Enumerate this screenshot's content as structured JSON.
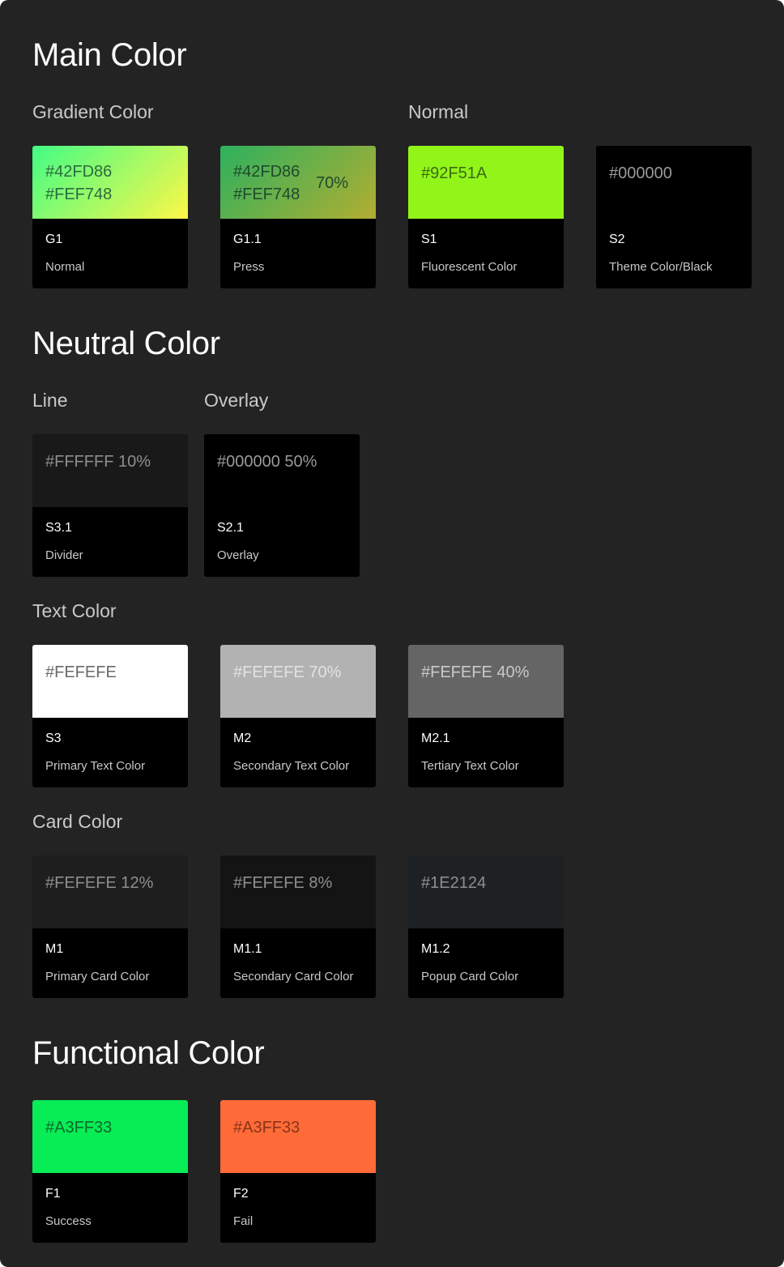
{
  "sections": {
    "main": {
      "title": "Main Color",
      "gradient_heading": "Gradient Color",
      "normal_heading": "Normal",
      "cards": [
        {
          "hex1": "#42FD86",
          "hex2": "#FEF748",
          "code": "G1",
          "label": "Normal"
        },
        {
          "hex1": "#42FD86",
          "hex2": "#FEF748",
          "pct": "70%",
          "code": "G1.1",
          "label": "Press"
        },
        {
          "hex1": "#92F51A",
          "code": "S1",
          "label": "Fluorescent Color"
        },
        {
          "hex1": "#000000",
          "code": "S2",
          "label": "Theme Color/Black"
        }
      ]
    },
    "neutral": {
      "title": "Neutral Color",
      "line_heading": "Line",
      "overlay_heading": "Overlay",
      "text_heading": "Text Color",
      "card_heading": "Card Color",
      "line_cards": [
        {
          "hex1": "#FFFFFF 10%",
          "code": "S3.1",
          "label": "Divider"
        },
        {
          "hex1": "#000000 50%",
          "code": "S2.1",
          "label": "Overlay"
        }
      ],
      "text_cards": [
        {
          "hex1": "#FEFEFE",
          "code": "S3",
          "label": "Primary Text Color"
        },
        {
          "hex1": "#FEFEFE 70%",
          "code": "M2",
          "label": "Secondary Text Color"
        },
        {
          "hex1": "#FEFEFE 40%",
          "code": "M2.1",
          "label": "Tertiary Text Color"
        }
      ],
      "card_cards": [
        {
          "hex1": "#FEFEFE 12%",
          "code": "M1",
          "label": "Primary Card Color"
        },
        {
          "hex1": "#FEFEFE 8%",
          "code": "M1.1",
          "label": "Secondary Card Color"
        },
        {
          "hex1": "#1E2124",
          "code": "M1.2",
          "label": "Popup Card Color"
        }
      ]
    },
    "functional": {
      "title": "Functional Color",
      "cards": [
        {
          "hex1": "#A3FF33",
          "code": "F1",
          "label": "Success"
        },
        {
          "hex1": "#A3FF33",
          "code": "F2",
          "label": "Fail"
        }
      ]
    }
  },
  "colors": {
    "page_bg": "#232324",
    "g1_gradient": [
      "#42FD86",
      "#FEF748"
    ],
    "g1_1_gradient": [
      "#2DB15E",
      "#B2AD32"
    ],
    "s1": "#92F51A",
    "s2": "#000000",
    "s3_1": "#191919",
    "s2_1": "#000000",
    "s3": "#FEFEFE",
    "m2": "#B2B2B2",
    "m2_1": "#656565",
    "m1": "#1E1E1E",
    "m1_1": "#141414",
    "m1_2": "#1E2124",
    "f1": "#08EC55",
    "f2": "#FF6B38"
  }
}
